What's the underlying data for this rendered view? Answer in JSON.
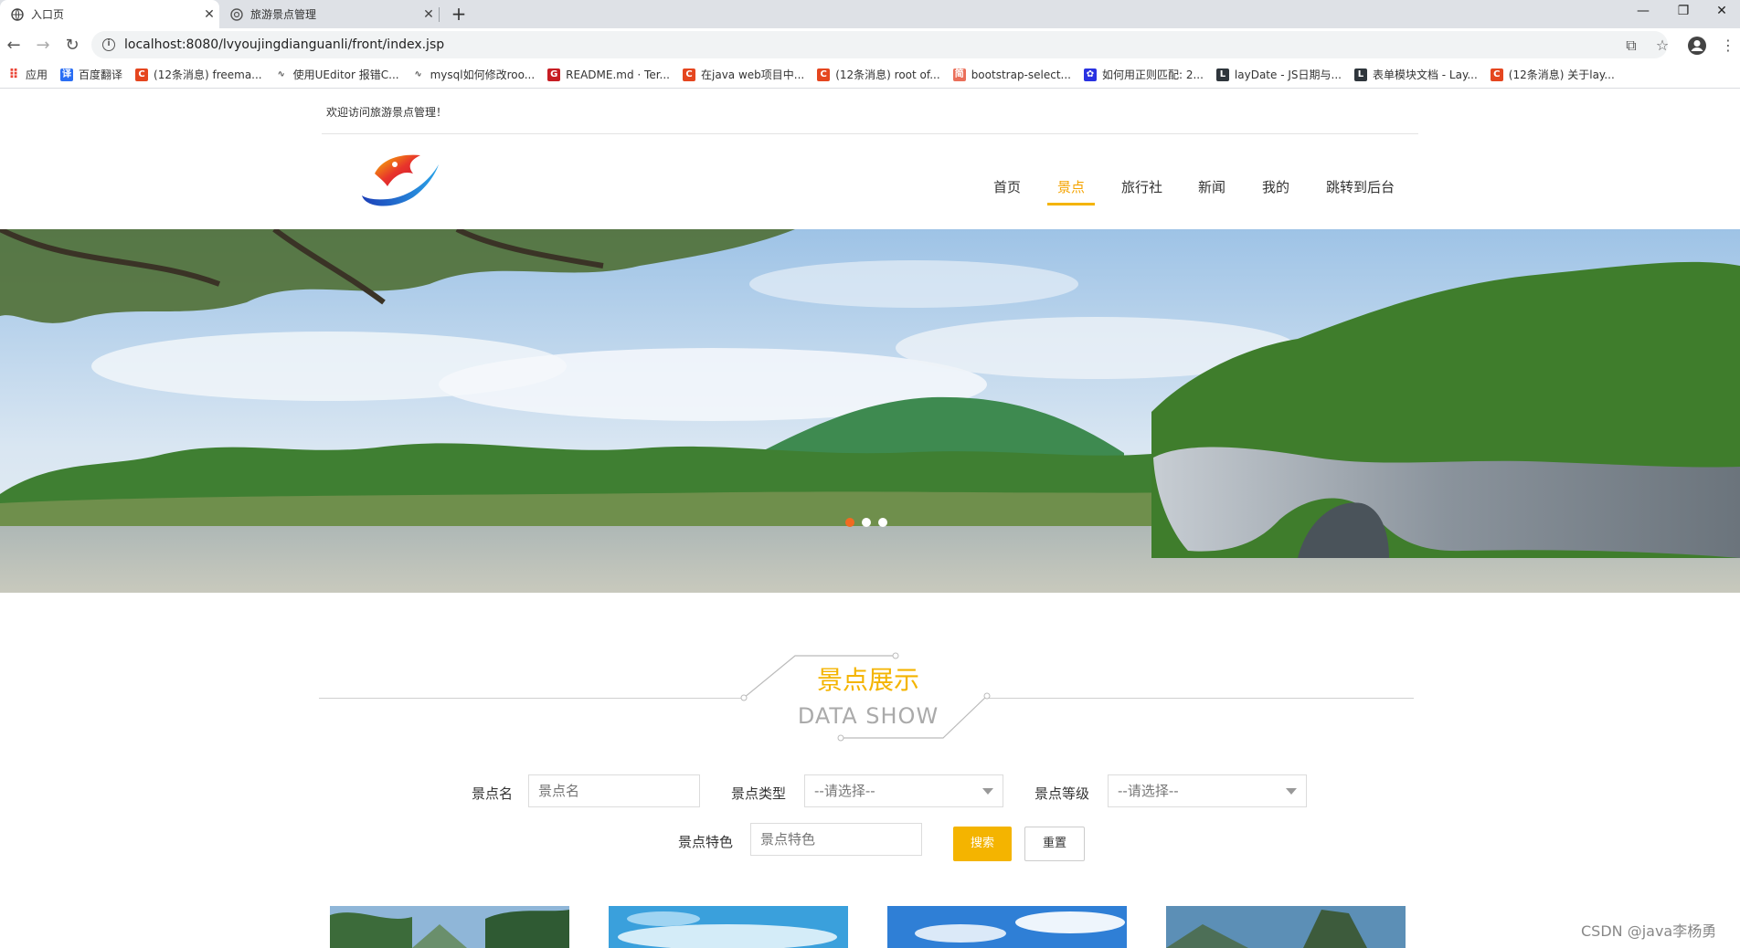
{
  "browser": {
    "tabs": [
      {
        "title": "入口页",
        "active": true
      },
      {
        "title": "旅游景点管理",
        "active": false
      }
    ],
    "url": "localhost:8080/lvyoujingdianguanli/front/index.jsp",
    "bookmarks": [
      {
        "label": "应用",
        "icon": "apps-grid-icon",
        "color": "#ea4335"
      },
      {
        "label": "百度翻译",
        "icon": "baidu-translate-icon",
        "color": "#2a6ef4"
      },
      {
        "label": "(12条消息) freema...",
        "icon": "csdn-icon",
        "color": "#e5461f"
      },
      {
        "label": "使用UEditor 报错C...",
        "icon": "link-icon",
        "color": "#555555"
      },
      {
        "label": "mysql如何修改roo...",
        "icon": "link-icon",
        "color": "#555555"
      },
      {
        "label": "README.md · Ter...",
        "icon": "gitee-icon",
        "color": "#c71d23"
      },
      {
        "label": "在java web项目中...",
        "icon": "csdn-icon",
        "color": "#e5461f"
      },
      {
        "label": "(12条消息) root of...",
        "icon": "csdn-icon",
        "color": "#e5461f"
      },
      {
        "label": "bootstrap-select...",
        "icon": "jianshu-icon",
        "color": "#ea6f5a"
      },
      {
        "label": "如何用正则匹配: 2...",
        "icon": "baidu-paw-icon",
        "color": "#2932e1"
      },
      {
        "label": "layDate - JS日期与...",
        "icon": "layui-icon",
        "color": "#2f363c"
      },
      {
        "label": "表单模块文档 - Lay...",
        "icon": "layui-icon",
        "color": "#2f363c"
      },
      {
        "label": "(12条消息) 关于lay...",
        "icon": "csdn-icon",
        "color": "#e5461f"
      }
    ]
  },
  "header": {
    "welcome": "欢迎访问旅游景点管理！",
    "nav": [
      {
        "label": "首页",
        "active": false
      },
      {
        "label": "景点",
        "active": true
      },
      {
        "label": "旅行社",
        "active": false
      },
      {
        "label": "新闻",
        "active": false
      },
      {
        "label": "我的",
        "active": false
      },
      {
        "label": "跳转到后台",
        "active": false
      }
    ]
  },
  "carousel": {
    "active_index": 0,
    "slides": 3
  },
  "section": {
    "title": "景点展示",
    "subtitle": "DATA SHOW"
  },
  "filters": {
    "name_label": "景点名",
    "name_placeholder": "景点名",
    "type_label": "景点类型",
    "type_value": "--请选择--",
    "level_label": "景点等级",
    "level_value": "--请选择--",
    "feature_label": "景点特色",
    "feature_placeholder": "景点特色",
    "search_button": "搜索",
    "reset_button": "重置"
  },
  "watermark": "CSDN @java李杨勇",
  "colors": {
    "accent": "#f4b400",
    "dot_active": "#f26a21"
  }
}
